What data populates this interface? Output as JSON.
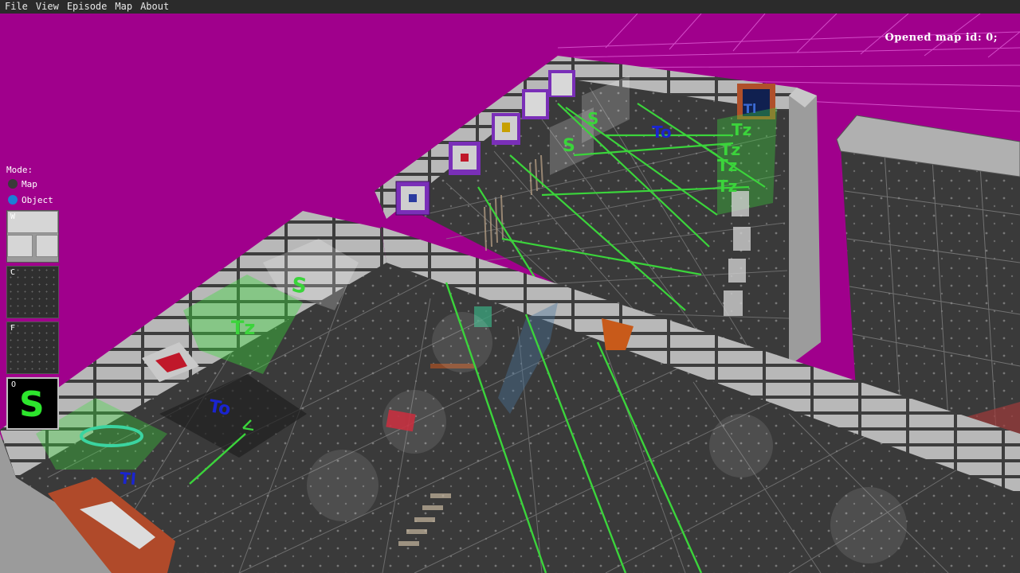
{
  "menu": {
    "items": [
      "File",
      "View",
      "Episode",
      "Map",
      "About"
    ]
  },
  "status": {
    "map_id_text": "Opened map id: 0;"
  },
  "mode_panel": {
    "title": "Mode:",
    "options": [
      {
        "label": "Map",
        "selected": false
      },
      {
        "label": "Object",
        "selected": true
      }
    ],
    "tools": [
      {
        "key": "W",
        "kind": "wall"
      },
      {
        "key": "C",
        "kind": "ceiling"
      },
      {
        "key": "F",
        "kind": "floor"
      },
      {
        "key": "O",
        "kind": "object",
        "glyph": "S"
      }
    ]
  },
  "scene_labels": {
    "s1": "S",
    "s2": "S",
    "s3": "S",
    "t1": "Tz",
    "t2": "Tz",
    "t3": "Tz",
    "t4": "Tz",
    "t5": "Tz",
    "to1": "To",
    "to2": "To",
    "tl": "Tl"
  },
  "colors": {
    "background": "#a0008c",
    "grid": "#e060d8",
    "laser": "#3bd43b",
    "wall": "#a6a6a6",
    "floor": "#3a3a3a",
    "select_blue": "#1c7ed6"
  }
}
